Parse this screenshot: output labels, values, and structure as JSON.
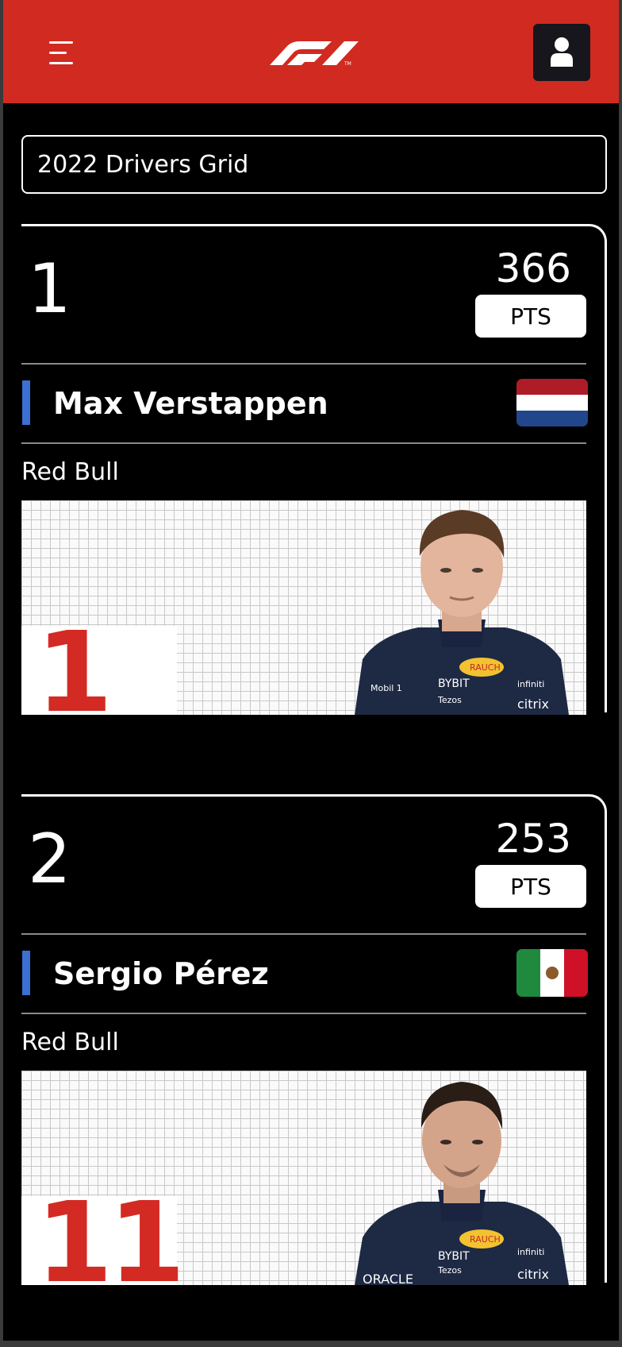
{
  "app": {
    "brand": "F1"
  },
  "header": {
    "menu_icon": "hamburger-menu-icon",
    "logo": "f1-logo",
    "account_icon": "user-icon",
    "brand_color": "#d12a20"
  },
  "search": {
    "value": "2022 Drivers Grid"
  },
  "drivers": [
    {
      "position": "1",
      "points": "366",
      "points_label": "PTS",
      "name": "Max Verstappen",
      "team": "Red Bull",
      "flag": "Netherlands",
      "number": "1",
      "team_color": "#3d6fd3"
    },
    {
      "position": "2",
      "points": "253",
      "points_label": "PTS",
      "name": "Sergio Pérez",
      "team": "Red Bull",
      "flag": "Mexico",
      "number": "11",
      "team_color": "#3d6fd3"
    }
  ]
}
